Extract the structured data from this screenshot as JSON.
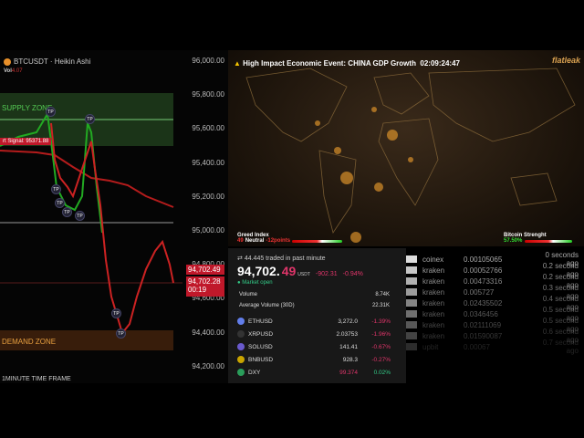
{
  "chart": {
    "symbol": "BTCUSDT · Heikin Ashi",
    "vol_label": "Vol",
    "vol_value": "4.07",
    "axis": [
      "96,000.00",
      "95,800.00",
      "95,600.00",
      "95,400.00",
      "95,200.00",
      "95,000.00",
      "94,800.00",
      "94,600.00",
      "94,400.00",
      "94,200.00"
    ],
    "supply_label": "SUPPLY ZONE",
    "demand_label": "DEMAND ZONE",
    "signal": "rt Signal: 95371.88",
    "tp": "TP",
    "price_tag": "94,702.49",
    "price_tag2": "94,702.28",
    "countdown": "00:19",
    "timeframe": "1MINUTE TIME FRAME"
  },
  "map": {
    "event": "High Impact Economic Event: CHINA GDP Growth",
    "event_time": "02:09:24:47",
    "logo": "flatleak",
    "greed_title": "Greed Index",
    "greed_value": "49",
    "greed_label": "Neutral",
    "greed_change": "-12points",
    "strength_title": "Bitcoin Strenght",
    "strength_value": "57.50%"
  },
  "info": {
    "traded": "44.445 traded in past minute",
    "price_main": "94,702.",
    "price_dec": "49",
    "currency": "USDT",
    "change": "-902.31",
    "change_pct": "-0.94%",
    "market": "Market open",
    "volume_label": "Volume",
    "volume": "8.74K",
    "avg_label": "Average Volume (30D)",
    "avg": "22.31K",
    "tickers": [
      {
        "sym": "ETHUSD",
        "price": "3,272.0",
        "chg": "-1.39%",
        "color": "#627eea",
        "up": false
      },
      {
        "sym": "XRPUSD",
        "price": "2.03753",
        "chg": "-1.96%",
        "color": "#333",
        "up": false
      },
      {
        "sym": "SOLUSD",
        "price": "141.41",
        "chg": "-0.67%",
        "color": "#6a5acd",
        "up": false
      },
      {
        "sym": "BNBUSD",
        "price": "928.3",
        "chg": "-0.27%",
        "color": "#c9a400",
        "up": false
      },
      {
        "sym": "DXY",
        "price": "99.374",
        "chg": "0.02%",
        "color": "#2a9d5a",
        "up": true
      }
    ]
  },
  "trades": [
    {
      "ex": "coinex",
      "amt": "0.00105065",
      "time": "0 seconds ago"
    },
    {
      "ex": "kraken",
      "amt": "0.00052766",
      "time": "0.2 second ago"
    },
    {
      "ex": "kraken",
      "amt": "0.00473316",
      "time": "0.2 second ago"
    },
    {
      "ex": "kraken",
      "amt": "0.005727",
      "time": "0.3 second ago"
    },
    {
      "ex": "kraken",
      "amt": "0.02435502",
      "time": "0.4 second ago"
    },
    {
      "ex": "kraken",
      "amt": "0.0346456",
      "time": "0.5 second ago"
    },
    {
      "ex": "kraken",
      "amt": "0.02111069",
      "time": "0.5 second ago"
    },
    {
      "ex": "kraken",
      "amt": "0.01590087",
      "time": "0.6 second ago"
    },
    {
      "ex": "upbit",
      "amt": "0.00067",
      "time": "0.7 second ago"
    }
  ]
}
